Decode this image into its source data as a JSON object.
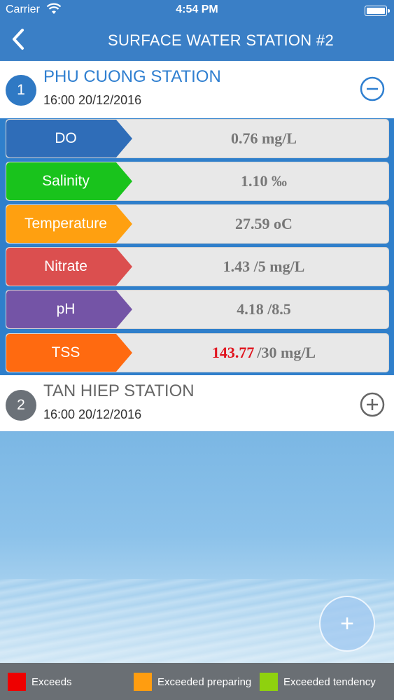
{
  "status_bar": {
    "carrier": "Carrier",
    "time": "4:54 PM"
  },
  "header": {
    "title": "SURFACE WATER STATION #2"
  },
  "stations": [
    {
      "number": "1",
      "name": "PHU CUONG STATION",
      "datetime": "16:00 20/12/2016",
      "expanded": true,
      "parameters": [
        {
          "name": "DO",
          "value": "0.76 mg/L",
          "color": "#2f6db8"
        },
        {
          "name": "Salinity",
          "value": "1.10 ‰",
          "color": "#19c31c"
        },
        {
          "name": "Temperature",
          "value": "27.59 oC",
          "color": "#ffa010"
        },
        {
          "name": "Nitrate",
          "value": "1.43 /5 mg/L",
          "color": "#db4f4f"
        },
        {
          "name": "pH",
          "value": "4.18 /8.5",
          "color": "#7454a6"
        },
        {
          "name": "TSS",
          "value_exceeded": "143.77",
          "value": "/30 mg/L",
          "color": "#ff6a10",
          "exceeded_color": "#e0141e"
        }
      ]
    },
    {
      "number": "2",
      "name": "TAN HIEP STATION",
      "datetime": "16:00 20/12/2016",
      "expanded": false
    }
  ],
  "fab": {
    "label": "+"
  },
  "legend": [
    {
      "label": "Exceeds",
      "color": "#ee0000"
    },
    {
      "label": "Exceeded preparing",
      "color": "#ff9d10"
    },
    {
      "label": "Exceeded tendency",
      "color": "#8fd10e"
    }
  ],
  "icons": {
    "back": "chevron-left-icon",
    "collapse": "minus-circle-icon",
    "expand": "plus-circle-icon",
    "wifi": "wifi-icon",
    "battery": "battery-icon"
  }
}
